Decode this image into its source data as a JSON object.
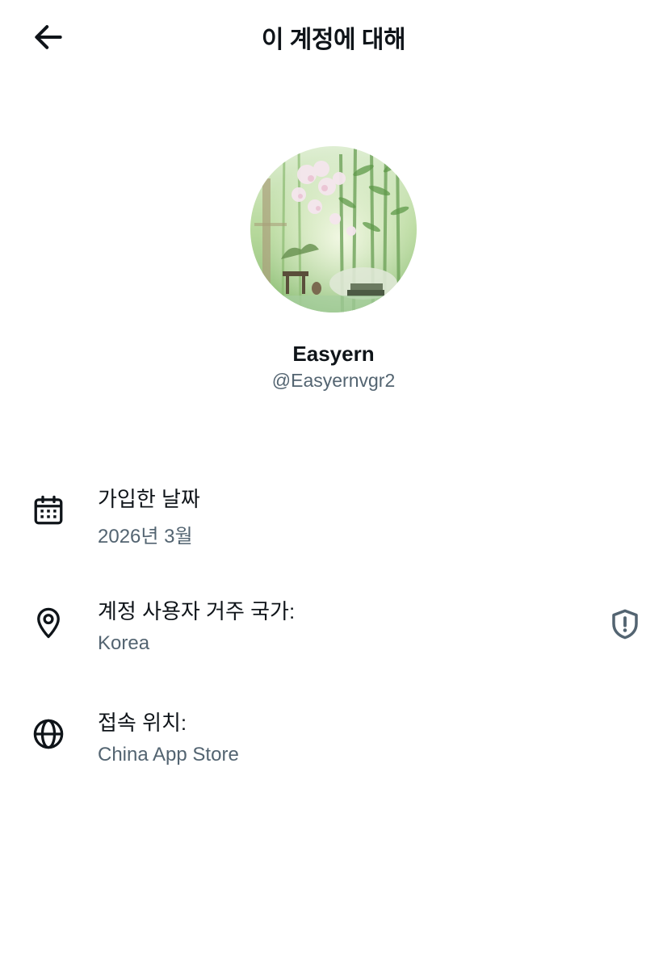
{
  "header": {
    "title": "이 계정에 대해",
    "back_icon": "arrow-left-icon"
  },
  "profile": {
    "display_name": "Easyern",
    "handle": "@Easyernvgr2",
    "avatar": "bamboo-garden-illustration"
  },
  "details": [
    {
      "icon": "calendar-icon",
      "label": "가입한 날짜",
      "value": "2026년 3월"
    },
    {
      "icon": "location-pin-icon",
      "label": "계정 사용자 거주 국가:",
      "value": "Korea",
      "action_icon": "shield-alert-icon"
    },
    {
      "icon": "globe-icon",
      "label": "접속 위치:",
      "value": "China App Store"
    }
  ],
  "colors": {
    "text_primary": "#0f1419",
    "text_secondary": "#536471",
    "background": "#ffffff"
  }
}
